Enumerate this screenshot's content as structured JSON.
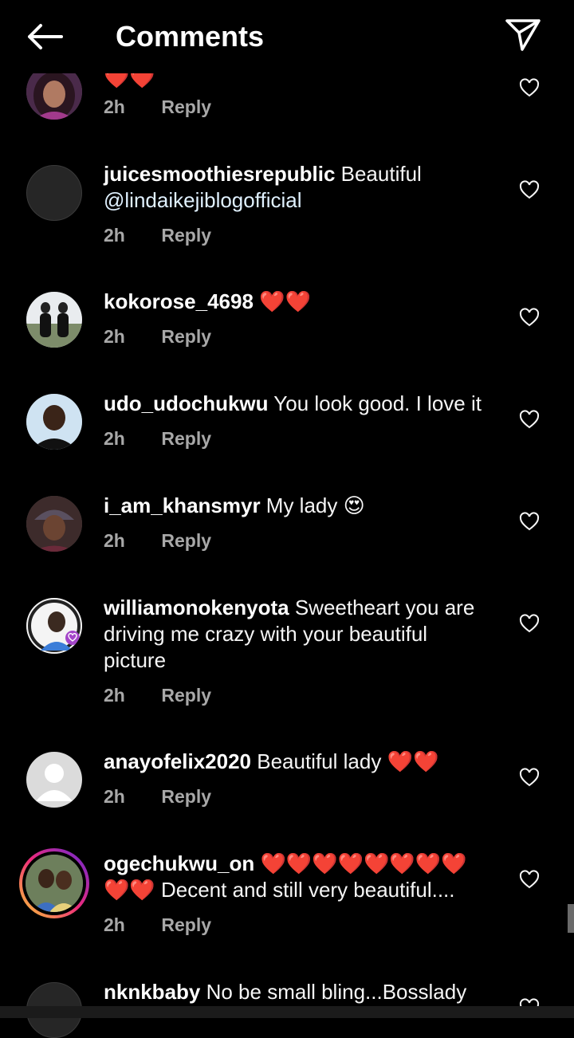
{
  "header": {
    "title": "Comments"
  },
  "comments": [
    {
      "username": "",
      "text": "",
      "hearts": "❤️❤️",
      "time": "2h",
      "reply": "Reply"
    },
    {
      "username": "juicesmoothiesrepublic",
      "text": " Beautiful",
      "mention": "@lindaikejiblogofficial",
      "time": "2h",
      "reply": "Reply"
    },
    {
      "username": "kokorose_4698",
      "text": " ❤️❤️",
      "time": "2h",
      "reply": "Reply"
    },
    {
      "username": "udo_udochukwu",
      "text": " You look good. I love it",
      "time": "2h",
      "reply": "Reply"
    },
    {
      "username": "i_am_khansmyr",
      "text": " My lady 😍",
      "time": "2h",
      "reply": "Reply"
    },
    {
      "username": "williamonokenyota",
      "text": " Sweetheart you are driving me crazy with your beautiful picture",
      "time": "2h",
      "reply": "Reply"
    },
    {
      "username": "anayofelix2020",
      "text": " Beautiful lady ❤️❤️",
      "time": "2h",
      "reply": "Reply"
    },
    {
      "username": "ogechukwu_on",
      "text": " ❤️❤️❤️❤️❤️❤️❤️❤️❤️❤️ Decent and still very beautiful....",
      "time": "2h",
      "reply": "Reply"
    },
    {
      "username": "nknkbaby",
      "text": " No be small bling...Bosslady",
      "time": "",
      "reply": ""
    }
  ],
  "icons": {
    "back": "arrow-left-icon",
    "send": "paper-plane-icon",
    "like": "heart-outline-icon"
  },
  "colors": {
    "background": "#000000",
    "text": "#f5f5f5",
    "meta": "#a8a8a8",
    "heart": "#ed2939"
  }
}
